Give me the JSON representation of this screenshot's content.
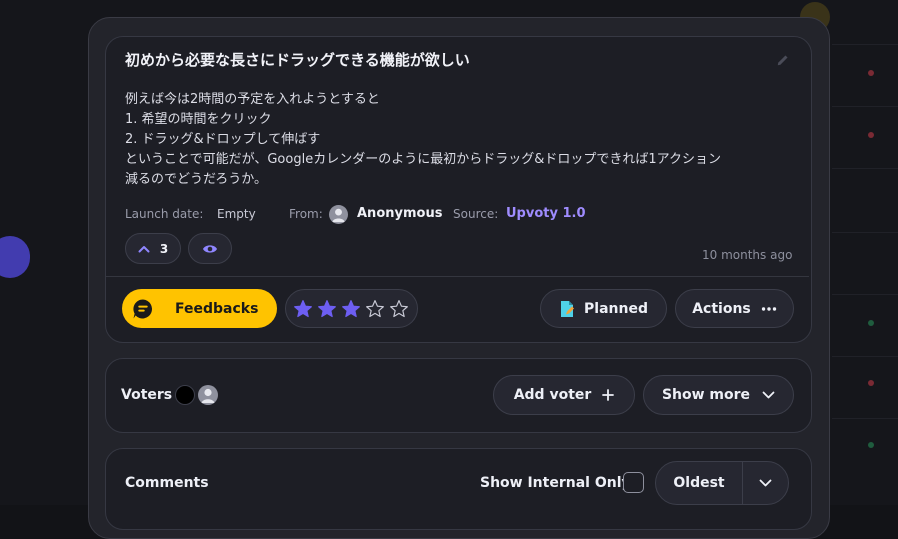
{
  "feedback": {
    "title": "初めから必要な長さにドラッグできる機能が欲しい",
    "description_lines": [
      "例えば今は2時間の予定を入れようとすると",
      "1. 希望の時間をクリック",
      "2. ドラッグ&ドロップして伸ばす",
      "ということで可能だが、Googleカレンダーのように最初からドラッグ&ドロップできれば1アクション",
      "減るのでどうだろうか。"
    ],
    "launch_date_label": "Launch date:",
    "launch_date_value": "Empty",
    "from_label": "From:",
    "author": "Anonymous",
    "source_label": "Source:",
    "source_value": "Upvoty 1.0",
    "vote_count": "3",
    "timestamp": "10 months ago"
  },
  "actions": {
    "feedbacks_label": "Feedbacks",
    "rating": 3,
    "rating_max": 5,
    "status_label": "Planned",
    "actions_label": "Actions"
  },
  "voters": {
    "label": "Voters",
    "add_voter_label": "Add voter",
    "show_more_label": "Show more"
  },
  "comments": {
    "label": "Comments",
    "show_internal_label": "Show Internal Only",
    "sort_value": "Oldest"
  },
  "colors": {
    "accent_yellow": "#ffc300",
    "accent_purple": "#9f8cff",
    "star_filled": "#6d5ef2",
    "planned_icon": "#4fd1e8"
  },
  "icons": [
    "edit-icon",
    "chevron-up-icon",
    "eye-icon",
    "chat-icon",
    "star-icon",
    "document-icon",
    "more-dots-icon",
    "plus-icon",
    "chevron-down-icon",
    "user-icon"
  ]
}
